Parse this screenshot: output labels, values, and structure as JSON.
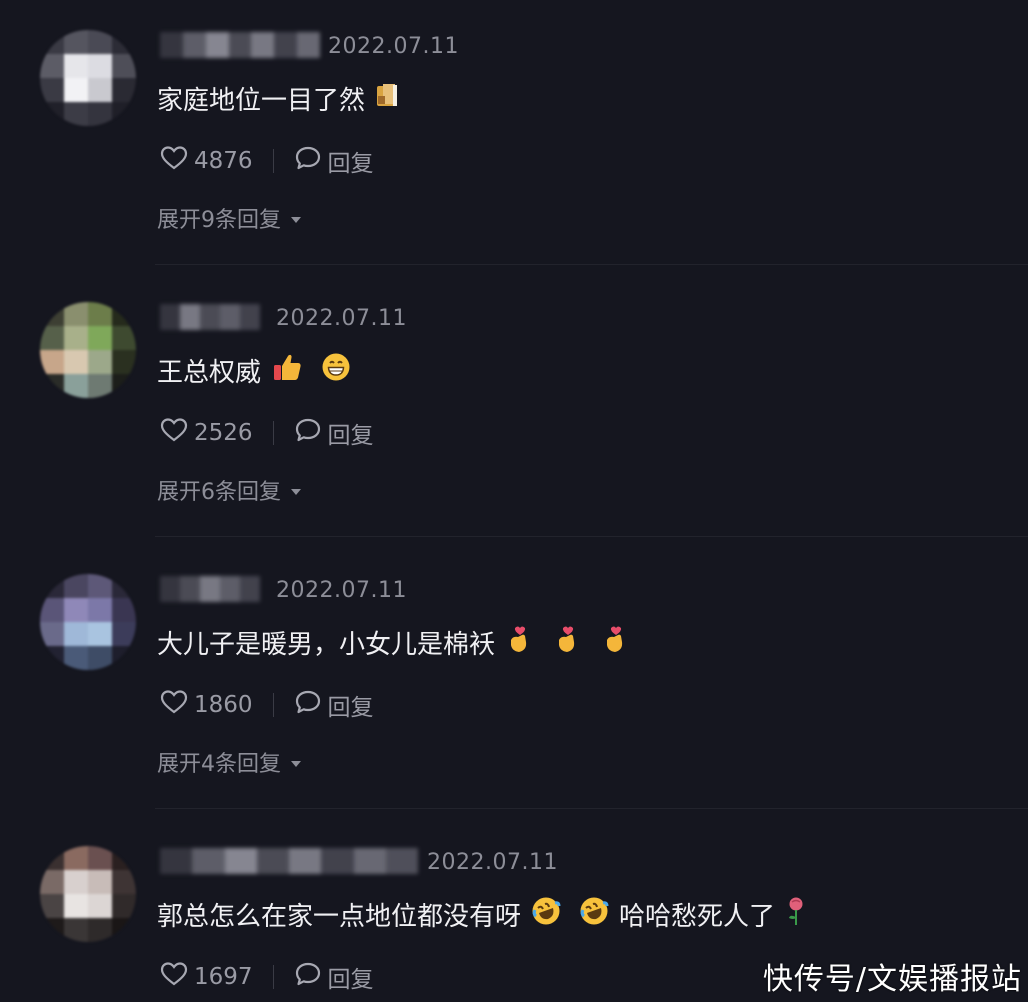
{
  "comments": [
    {
      "date": "2022.07.11",
      "text": "家庭地位一目了然",
      "likes": "4876",
      "reply_label": "回复",
      "expand_label": "展开9条回复",
      "avatar_colors": [
        "#3a3a44",
        "#55555f",
        "#4a4a55",
        "#2c2c36",
        "#5c5c66",
        "#e6e6ea",
        "#dcdce2",
        "#4e4e58",
        "#3a3a44",
        "#f2f2f5",
        "#c9c9cf",
        "#2a2a33",
        "#202029",
        "#3c3c46",
        "#34343e",
        "#1f1f28"
      ],
      "name_colors": [
        "#3b3b45",
        "#6a6a75",
        "#9a9aa5",
        "#55555f",
        "#8a8a95",
        "#4a4a55",
        "#777782"
      ],
      "emojis": [
        "grid-fence-emoji"
      ]
    },
    {
      "date": "2022.07.11",
      "text": "王总权威",
      "likes": "2526",
      "reply_label": "回复",
      "expand_label": "展开6条回复",
      "avatar_colors": [
        "#3d3f33",
        "#8a8f6e",
        "#6c7d4a",
        "#252a1c",
        "#56604a",
        "#a8b08a",
        "#7fa85a",
        "#3e4a30",
        "#c7a68a",
        "#d8c8b0",
        "#9ca88a",
        "#2a3020",
        "#2a2c28",
        "#8aa09a",
        "#6e7a72",
        "#1c1e1a"
      ],
      "name_colors": [
        "#3b3b45",
        "#8a8a95",
        "#55555f",
        "#6a6a75",
        "#4a4a55"
      ],
      "emojis": [
        "thumbs-up-emoji",
        "grinning-face-emoji"
      ]
    },
    {
      "date": "2022.07.11",
      "text": "大儿子是暖男，小女儿是棉袄",
      "likes": "1860",
      "reply_label": "回复",
      "expand_label": "展开4条回复",
      "avatar_colors": [
        "#2a2838",
        "#4a4660",
        "#5d5878",
        "#2a2838",
        "#5a5578",
        "#8f88b8",
        "#7c78a8",
        "#3a3652",
        "#6a6a8a",
        "#9fb8d8",
        "#a9c4e0",
        "#3c3c5a",
        "#222232",
        "#4a5a78",
        "#3e4c66",
        "#1e1e2c"
      ],
      "name_colors": [
        "#3b3b45",
        "#55555f",
        "#8a8a95",
        "#6a6a75",
        "#4a4a55"
      ],
      "emojis": [
        "finger-heart-emoji",
        "finger-heart-emoji",
        "finger-heart-emoji"
      ]
    },
    {
      "date": "2022.07.11",
      "text": "郭总怎么在家一点地位都没有呀",
      "text_tail": "哈哈愁死人了",
      "likes": "1697",
      "reply_label": "回复",
      "expand_label": "",
      "avatar_colors": [
        "#3a3030",
        "#8a6a60",
        "#6a5050",
        "#2a2020",
        "#7a6a66",
        "#d8d0ce",
        "#c8bcb8",
        "#3e3434",
        "#4a4444",
        "#e8e4e2",
        "#dcd6d4",
        "#302a2a",
        "#1e1a1a",
        "#3a3636",
        "#2e2a2a",
        "#1a1616"
      ],
      "name_colors": [
        "#3b3b45",
        "#6a6a75",
        "#9a9aa5",
        "#55555f",
        "#8a8a95",
        "#4a4a55",
        "#777782",
        "#5a5a65"
      ],
      "emojis": [
        "rolling-laughing-emoji",
        "rolling-laughing-emoji",
        "rose-emoji"
      ]
    }
  ],
  "watermark": "快传号/文娱播报站",
  "colors": {
    "background": "#15161f",
    "text": "#f0f0f3",
    "meta": "#8d8e98",
    "divider": "#22232c"
  }
}
